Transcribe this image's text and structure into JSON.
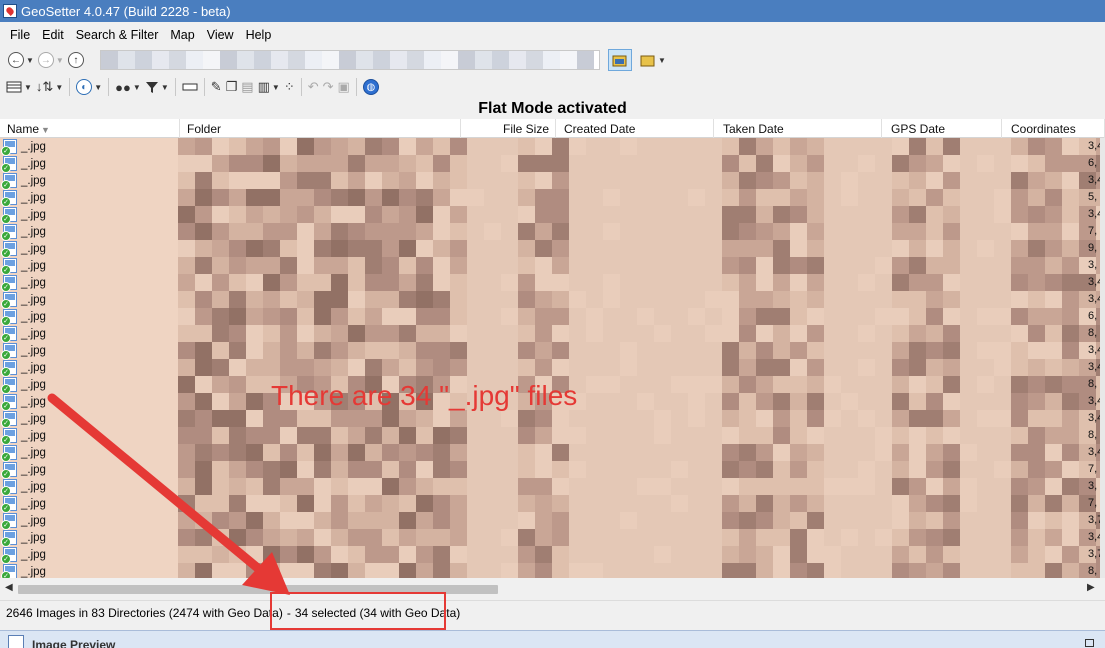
{
  "window": {
    "title": "GeoSetter 4.0.47 (Build 2228 - beta)"
  },
  "menu": [
    "File",
    "Edit",
    "Search & Filter",
    "Map",
    "View",
    "Help"
  ],
  "banner": "Flat Mode activated",
  "columns": [
    "Name",
    "Folder",
    "File Size",
    "Created Date",
    "Taken Date",
    "GPS Date",
    "Coordinates"
  ],
  "rows": [
    {
      "name": "_.jpg",
      "coord": "3,4"
    },
    {
      "name": "_.jpg",
      "coord": "6,"
    },
    {
      "name": "_.jpg",
      "coord": "3,4"
    },
    {
      "name": "_.jpg",
      "coord": "5,"
    },
    {
      "name": "_.jpg",
      "coord": "3,4"
    },
    {
      "name": "_.jpg",
      "coord": "7,"
    },
    {
      "name": "_.jpg",
      "coord": "9,"
    },
    {
      "name": "_.jpg",
      "coord": "3,"
    },
    {
      "name": "_.jpg",
      "coord": "3,4"
    },
    {
      "name": "_.jpg",
      "coord": "3,4"
    },
    {
      "name": "_.jpg",
      "coord": "6,"
    },
    {
      "name": "_.jpg",
      "coord": "8,"
    },
    {
      "name": "_.jpg",
      "coord": "3,4"
    },
    {
      "name": "_.jpg",
      "coord": "3,4"
    },
    {
      "name": "_.jpg",
      "coord": "8,"
    },
    {
      "name": "_.jpg",
      "coord": "3,4"
    },
    {
      "name": "_.jpg",
      "coord": "3,4"
    },
    {
      "name": "_.jpg",
      "coord": "8,"
    },
    {
      "name": "_.jpg",
      "coord": "3,4"
    },
    {
      "name": "_.jpg",
      "coord": "7,"
    },
    {
      "name": "_.jpg",
      "coord": "3,"
    },
    {
      "name": "_.jpg",
      "coord": "7,"
    },
    {
      "name": "_.jpg",
      "coord": "3,7"
    },
    {
      "name": "_.jpg",
      "coord": "3,4"
    },
    {
      "name": "_.jpg",
      "coord": "3,7"
    },
    {
      "name": "_.jpg",
      "coord": "8,"
    }
  ],
  "status": {
    "summary": "2646 Images in 83 Directories (2474 with Geo Data)",
    "separator": "-",
    "selected": "34 selected (34 with Geo Data)"
  },
  "preview_panel": {
    "title": "Image Preview"
  },
  "annotation": {
    "text": "There are 34 \"_.jpg\" files",
    "color": "#e53935"
  },
  "colors": {
    "titlebar": "#4a7ebf",
    "grid_bg": "#efd4c2",
    "annotation": "#e53935"
  },
  "icons": {
    "toolbar1": [
      "back-icon",
      "forward-icon",
      "up-icon",
      "folder-view-icon",
      "folder-options-icon"
    ],
    "toolbar2": [
      "view-mode-icon",
      "sort-icon",
      "map-icon",
      "binoculars-icon",
      "filter-icon",
      "rename-icon",
      "edit-icon",
      "copy-icon",
      "paste-icon",
      "document-icon",
      "footprints-icon",
      "undo-icon",
      "redo-icon",
      "save-icon",
      "globe-icon"
    ]
  }
}
